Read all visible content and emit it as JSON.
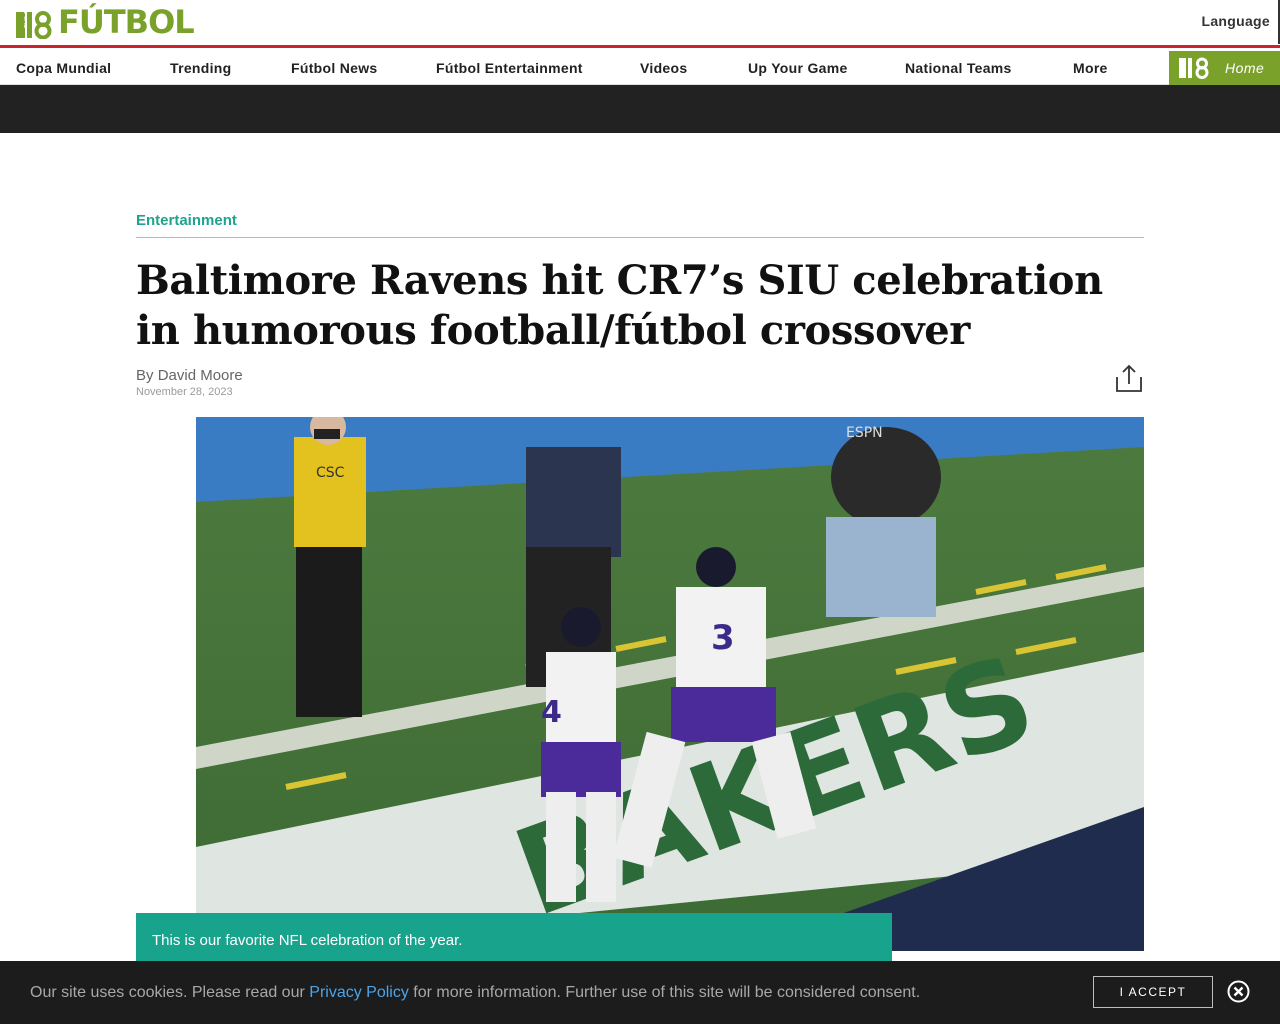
{
  "header": {
    "logo_text": "FÚTBOL",
    "logo_mark": "THE 18",
    "language_label": "Language"
  },
  "nav": {
    "items": [
      {
        "label": "Copa Mundial"
      },
      {
        "label": "Trending"
      },
      {
        "label": "Fútbol News"
      },
      {
        "label": "Fútbol Entertainment"
      },
      {
        "label": "Videos"
      },
      {
        "label": "Up Your Game"
      },
      {
        "label": "National Teams"
      },
      {
        "label": "More"
      }
    ],
    "home_label": "Home"
  },
  "article": {
    "category": "Entertainment",
    "headline": "Baltimore Ravens hit CR7’s SIU celebration in humorous football/fútbol crossover",
    "byline_prefix": "By",
    "author": "David Moore",
    "date": "November 28, 2023",
    "caption": "This is our favorite NFL celebration of the year."
  },
  "hero_image": {
    "jersey_numbers": [
      "3",
      "4"
    ],
    "vest_text": "CSC",
    "camera_text": "ESPN",
    "end_zone_text": "BAKERS"
  },
  "cookie_bar": {
    "text_before": "Our site uses cookies. Please read our",
    "policy_link": "Privacy Policy",
    "text_after": "for more information. Further use of this site will be considered consent.",
    "accept_label": "I ACCEPT"
  },
  "colors": {
    "brand_green": "#7aa12a",
    "accent_teal": "#18a38d",
    "header_red": "#c9252c",
    "dark_band": "#222222",
    "link_blue": "#4da3e6"
  }
}
